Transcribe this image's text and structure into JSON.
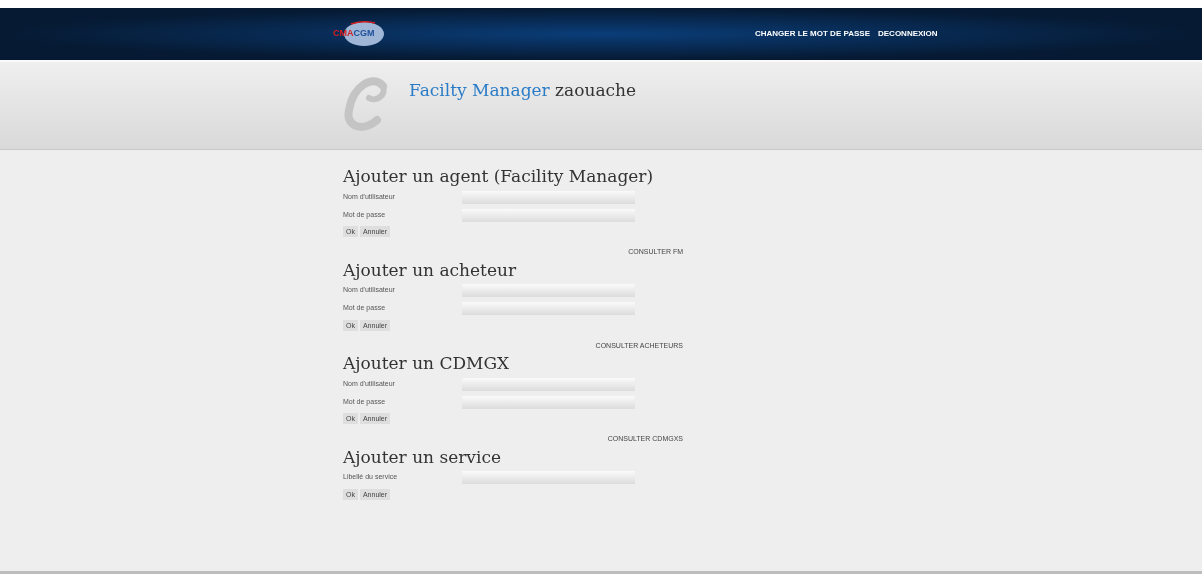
{
  "header": {
    "logo": {
      "left": "CMA",
      "right": "CGM"
    },
    "nav": [
      "CHANGER LE MOT DE PASSE",
      "DECONNEXION"
    ]
  },
  "banner": {
    "role": "Facilty Manager",
    "user": "zaouache"
  },
  "sections": [
    {
      "title": "Ajouter un agent (Facility Manager)",
      "fields": [
        {
          "label": "Nom d'utilisateur"
        },
        {
          "label": "Mot de passe"
        }
      ],
      "buttons": [
        "Ok",
        "Annuler"
      ]
    },
    {
      "link": "CONSULTER FM",
      "title": "Ajouter un acheteur",
      "fields": [
        {
          "label": "Nom d'utilisateur"
        },
        {
          "label": "Mot de passe"
        }
      ],
      "buttons": [
        "Ok",
        "Annuler"
      ]
    },
    {
      "link": "CONSULTER ACHETEURS",
      "title": "Ajouter un CDMGX",
      "fields": [
        {
          "label": "Nom d'utilisateur"
        },
        {
          "label": "Mot de passe"
        }
      ],
      "buttons": [
        "Ok",
        "Annuler"
      ]
    },
    {
      "link": "CONSULTER CDMGXS",
      "title": "Ajouter un service",
      "fields": [
        {
          "label": "Libellé du service"
        }
      ],
      "buttons": [
        "Ok",
        "Annuler"
      ]
    }
  ]
}
